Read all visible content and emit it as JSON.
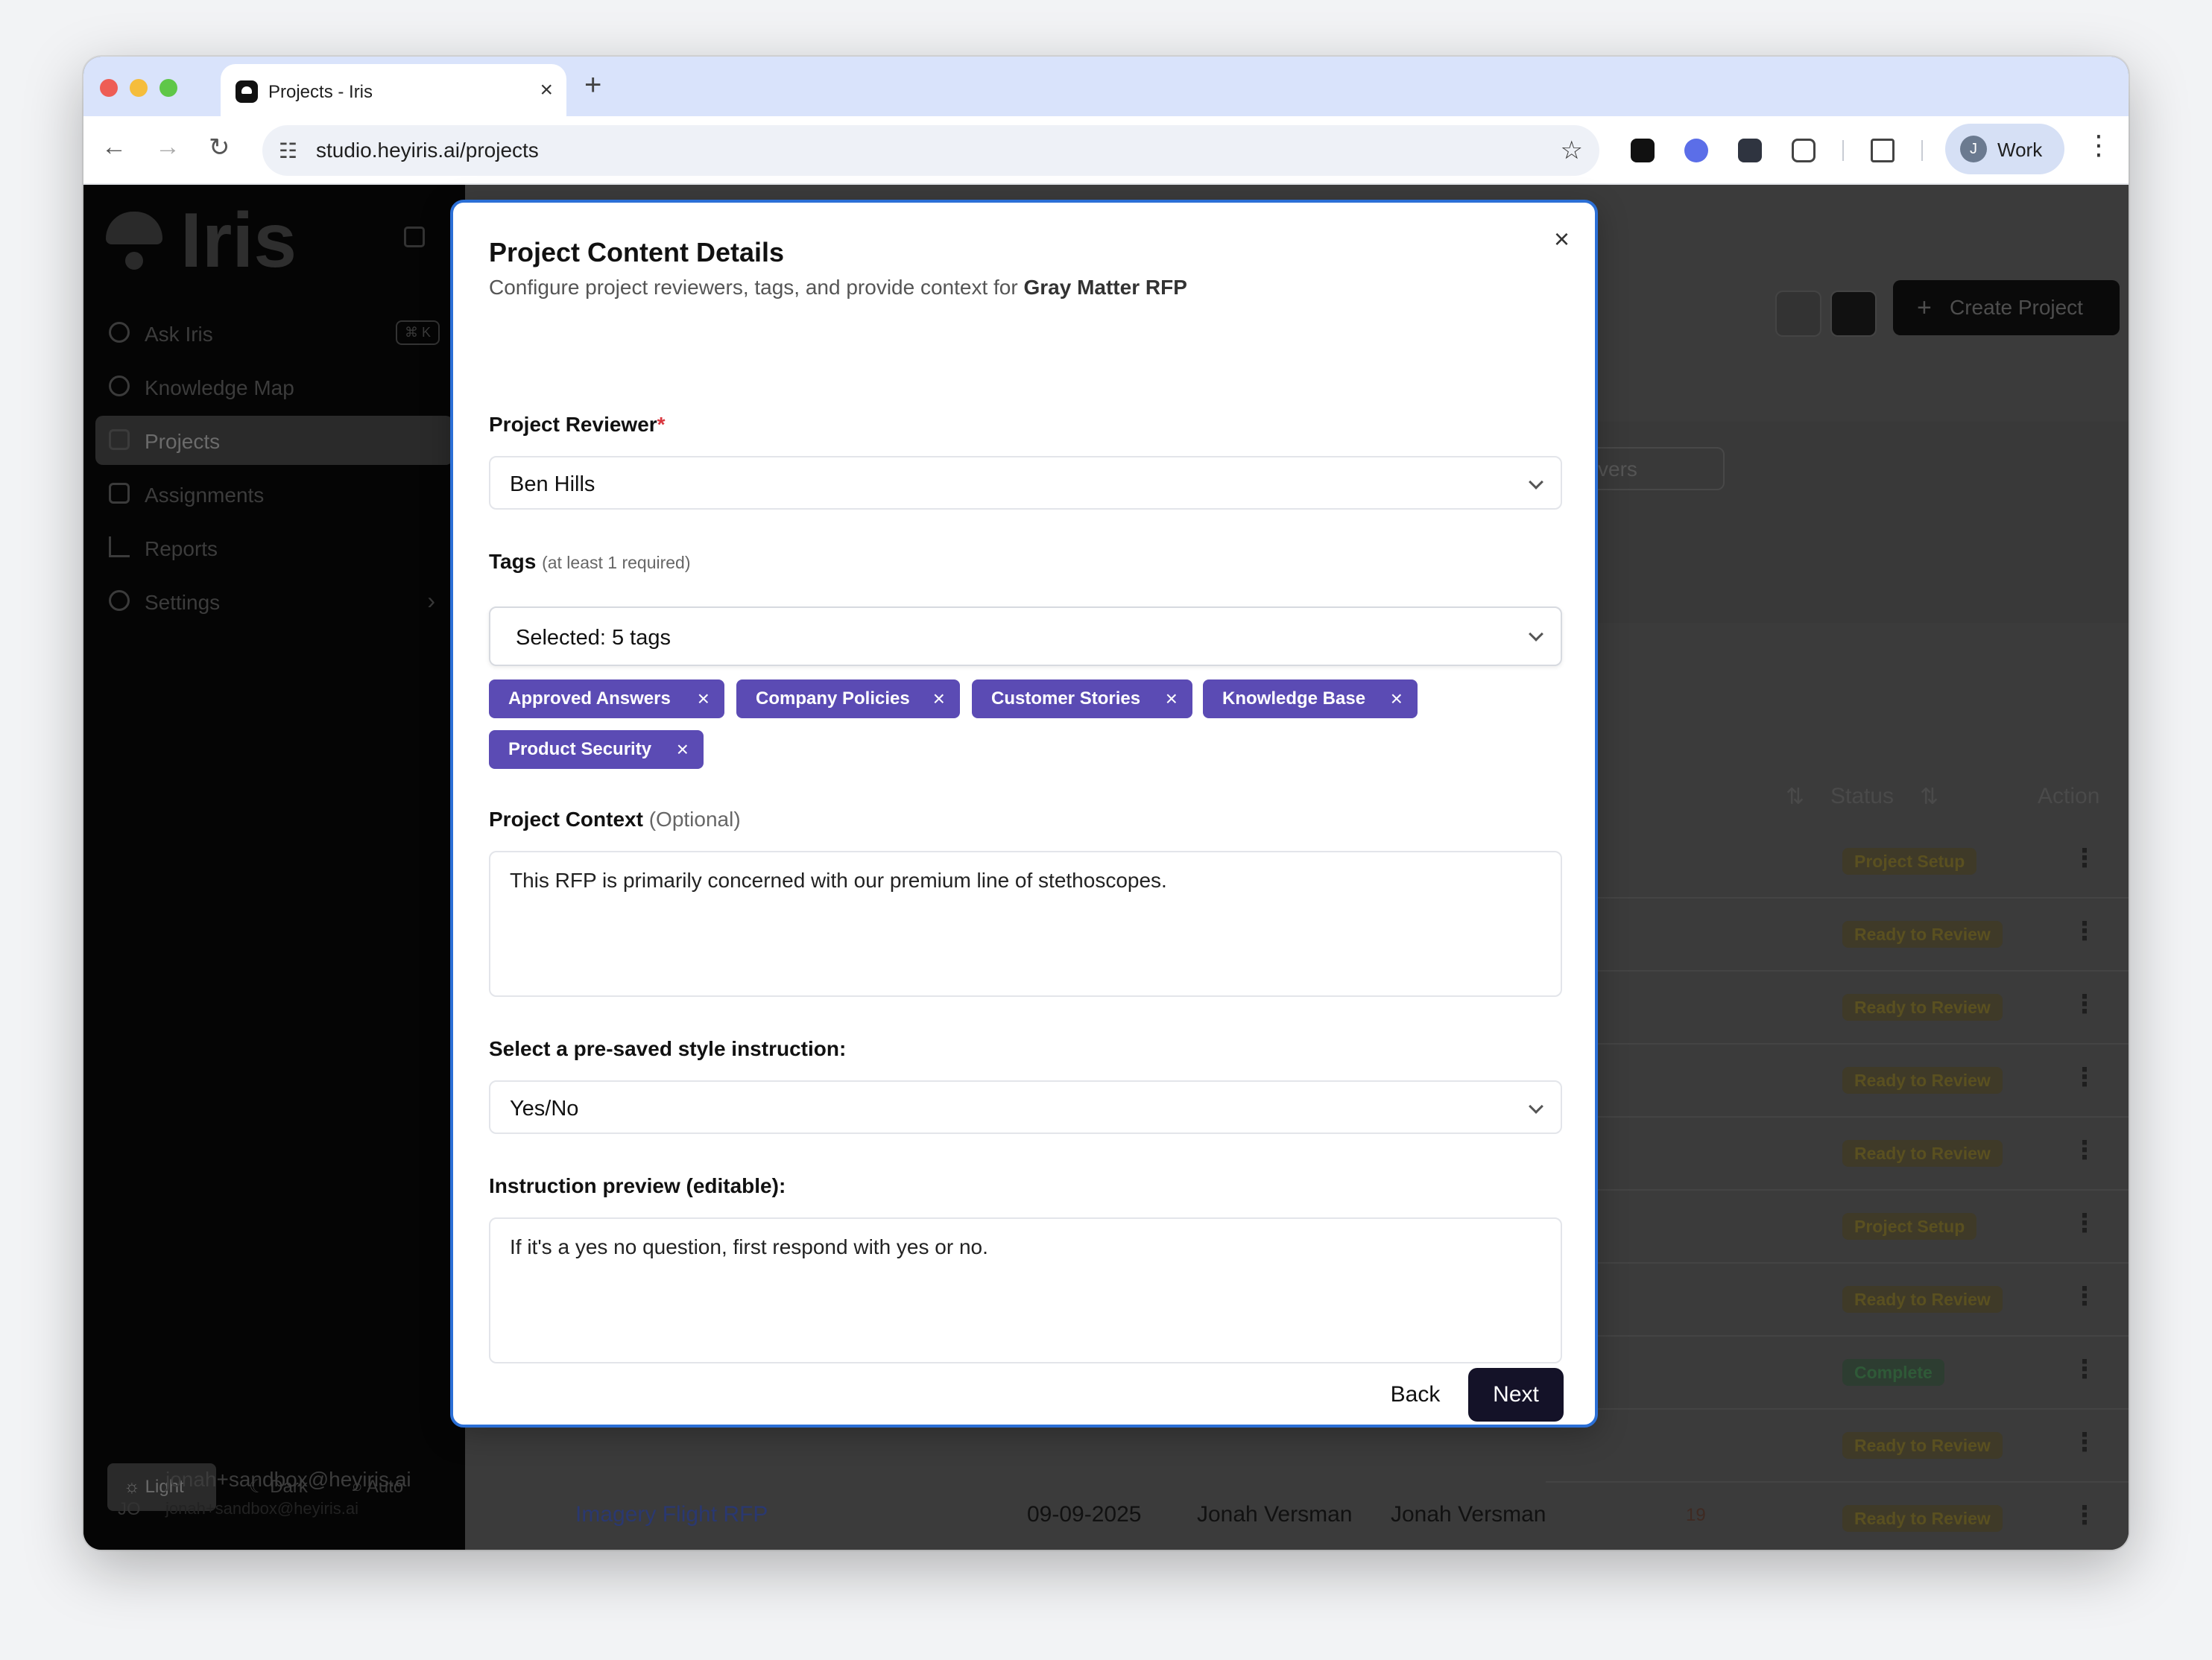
{
  "browser": {
    "tab_title": "Projects - Iris",
    "url": "studio.heyiris.ai/projects",
    "profile_initial": "J",
    "profile_label": "Work"
  },
  "sidebar": {
    "brand": "Iris",
    "items": [
      {
        "label": "Ask Iris",
        "shortcut": "⌘ K"
      },
      {
        "label": "Knowledge Map"
      },
      {
        "label": "Projects"
      },
      {
        "label": "Assignments"
      },
      {
        "label": "Reports"
      },
      {
        "label": "Settings"
      }
    ],
    "theme": {
      "light": "Light",
      "dark": "Dark",
      "auto": "Auto"
    },
    "user": {
      "initials": "JO",
      "name": "jonah+sandbox@heyiris.ai",
      "email": "jonah+sandbox@heyiris.ai"
    }
  },
  "background": {
    "create_project": "Create Project",
    "filter_partial": "vers",
    "columns": {
      "status": "Status",
      "action": "Action"
    },
    "statuses": [
      "Project Setup",
      "Ready to Review",
      "Ready to Review",
      "Ready to Review",
      "Ready to Review",
      "Project Setup",
      "Ready to Review",
      "Complete",
      "Ready to Review",
      "Ready to Review"
    ],
    "last_row": {
      "name": "Imagery Flight RFP",
      "date": "09-09-2025",
      "owner": "Jonah Versman",
      "reviewer": "Jonah Versman",
      "count": "19"
    }
  },
  "modal": {
    "title": "Project Content Details",
    "subtitle_prefix": "Configure project reviewers, tags, and provide context for ",
    "project_name": "Gray Matter RFP",
    "reviewer_label": "Project Reviewer",
    "required_mark": "*",
    "reviewer_value": "Ben Hills",
    "tags_label": "Tags",
    "tags_hint": "(at least 1 required)",
    "tags_selected": "Selected: 5 tags",
    "tags": [
      "Approved Answers",
      "Company Policies",
      "Customer Stories",
      "Knowledge Base",
      "Product Security"
    ],
    "context_label": "Project Context",
    "context_optional": "(Optional)",
    "context_value": "This RFP is primarily concerned with our premium line of stethoscopes.",
    "style_label": "Select a pre-saved style instruction:",
    "style_value": "Yes/No",
    "preview_label": "Instruction preview (editable):",
    "preview_value": "If it's a yes no question, first respond with yes or no.",
    "back_label": "Back",
    "next_label": "Next",
    "chip_remove": "×"
  },
  "colors": {
    "accent": "#5b4bb4",
    "primary_button": "#141228",
    "focus_border": "#2b6fd6",
    "required": "#d9363e"
  }
}
